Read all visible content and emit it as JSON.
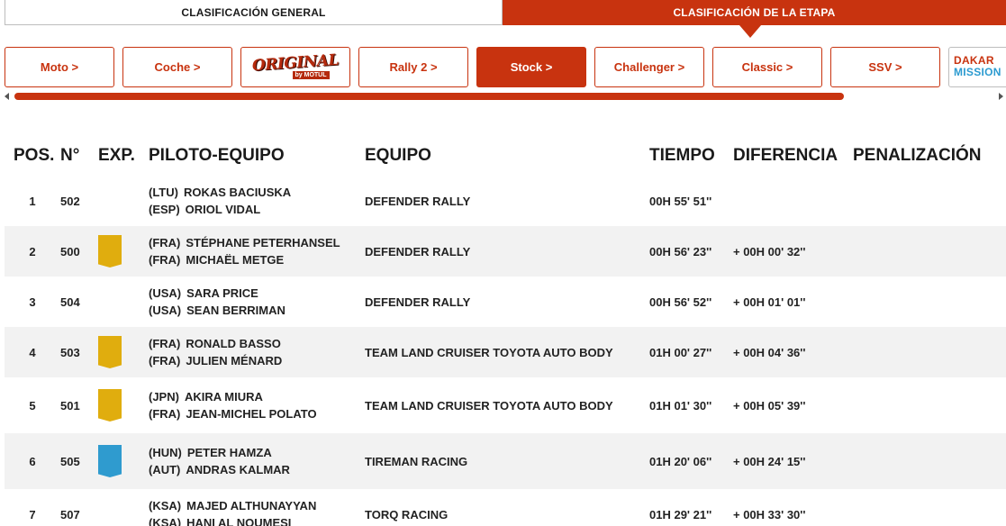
{
  "top_tabs": {
    "general": "CLASIFICACIÓN GENERAL",
    "etapa": "CLASIFICACIÓN DE LA ETAPA"
  },
  "categories": [
    {
      "label": "Moto >",
      "active": false
    },
    {
      "label": "Coche >",
      "active": false
    },
    {
      "label": "ORIGINAL",
      "sub": "by MOTUL",
      "type": "logo"
    },
    {
      "label": "Rally 2 >",
      "active": false
    },
    {
      "label": "Stock >",
      "active": true
    },
    {
      "label": "Challenger >",
      "active": false
    },
    {
      "label": "Classic >",
      "active": false
    },
    {
      "label": "SSV >",
      "active": false
    },
    {
      "label": "DAKAR",
      "sub": "MISSION",
      "type": "dakar"
    }
  ],
  "colors": {
    "accent": "#c8330f",
    "badge_gold": "#e0ad0e",
    "badge_blue": "#2f9bcf",
    "row_alt": "#f2f2f2"
  },
  "table": {
    "headers": {
      "pos": "POS.",
      "num": "N°",
      "exp": "EXP.",
      "pilot": "PILOTO-EQUIPO",
      "team": "EQUIPO",
      "time": "TIEMPO",
      "diff": "DIFERENCIA",
      "penalty": "PENALIZACIÓN"
    },
    "rows": [
      {
        "pos": "1",
        "num": "502",
        "exp": "",
        "nat1": "(LTU)",
        "name1": "ROKAS BACIUSKA",
        "nat2": "(ESP)",
        "name2": "ORIOL VIDAL",
        "team": "DEFENDER RALLY",
        "time": "00H 55' 51''",
        "diff": "",
        "penalty": ""
      },
      {
        "pos": "2",
        "num": "500",
        "exp": "gold",
        "nat1": "(FRA)",
        "name1": "STÉPHANE PETERHANSEL",
        "nat2": "(FRA)",
        "name2": "MICHAËL METGE",
        "team": "DEFENDER RALLY",
        "time": "00H 56' 23''",
        "diff": "+ 00H 00' 32''",
        "penalty": ""
      },
      {
        "pos": "3",
        "num": "504",
        "exp": "",
        "nat1": "(USA)",
        "name1": "SARA PRICE",
        "nat2": "(USA)",
        "name2": "SEAN BERRIMAN",
        "team": "DEFENDER RALLY",
        "time": "00H 56' 52''",
        "diff": "+ 00H 01' 01''",
        "penalty": ""
      },
      {
        "pos": "4",
        "num": "503",
        "exp": "gold",
        "nat1": "(FRA)",
        "name1": "RONALD BASSO",
        "nat2": "(FRA)",
        "name2": "JULIEN MÉNARD",
        "team": "TEAM LAND CRUISER TOYOTA AUTO BODY",
        "time": "01H 00' 27''",
        "diff": "+ 00H 04' 36''",
        "penalty": ""
      },
      {
        "pos": "5",
        "num": "501",
        "exp": "gold",
        "nat1": "(JPN)",
        "name1": "AKIRA MIURA",
        "nat2": "(FRA)",
        "name2": "JEAN-MICHEL POLATO",
        "team": "TEAM LAND CRUISER TOYOTA AUTO BODY",
        "time": "01H 01' 30''",
        "diff": "+ 00H 05' 39''",
        "penalty": ""
      },
      {
        "pos": "6",
        "num": "505",
        "exp": "blue",
        "nat1": "(HUN)",
        "name1": "PETER HAMZA",
        "nat2": "(AUT)",
        "name2": "ANDRAS KALMAR",
        "team": "TIREMAN RACING",
        "time": "01H 20' 06''",
        "diff": "+ 00H 24' 15''",
        "penalty": ""
      },
      {
        "pos": "7",
        "num": "507",
        "exp": "",
        "nat1": "(KSA)",
        "name1": "MAJED ALTHUNAYYAN",
        "nat2": "(KSA)",
        "name2": "HANI AL NOUMESI",
        "team": "TORQ RACING",
        "time": "01H 29' 21''",
        "diff": "+ 00H 33' 30''",
        "penalty": ""
      }
    ]
  }
}
